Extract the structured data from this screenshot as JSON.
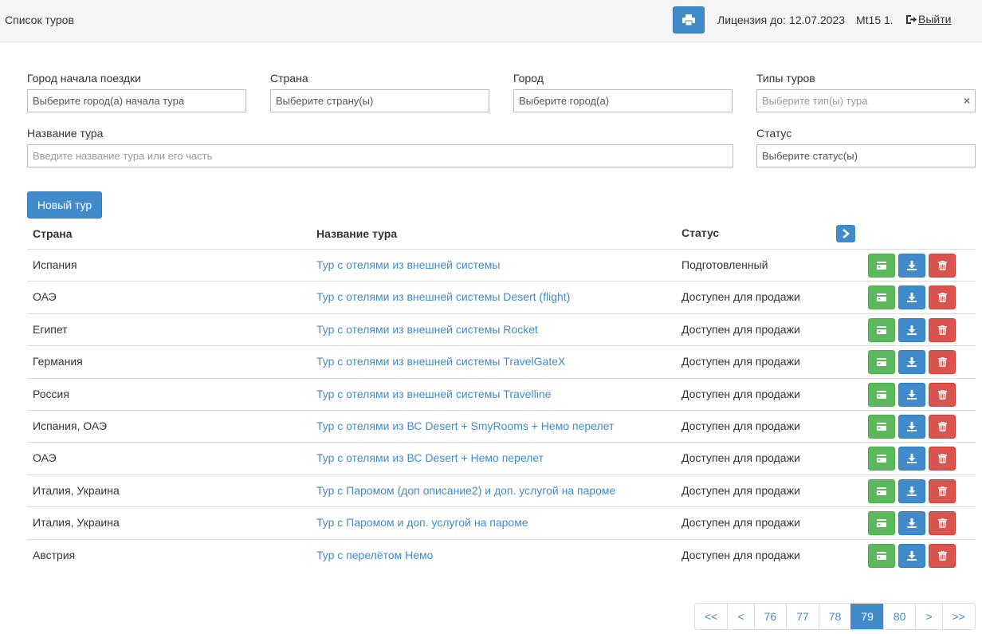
{
  "header": {
    "title": "Список туров",
    "license_label": "Лицензия до:",
    "license_date": "12.07.2023",
    "user": "Mt15 1.",
    "logout_label": "Выйти"
  },
  "filters": {
    "departure_city": {
      "label": "Город начала поездки",
      "placeholder": "Выберите город(а) начала тура"
    },
    "country": {
      "label": "Страна",
      "placeholder": "Выберите страну(ы)"
    },
    "city": {
      "label": "Город",
      "placeholder": "Выберите город(а)"
    },
    "tour_types": {
      "label": "Типы туров",
      "placeholder": "Выберите тип(ы) тура"
    },
    "tour_name": {
      "label": "Название тура",
      "placeholder": "Введите название тура или его часть"
    },
    "status": {
      "label": "Статус",
      "placeholder": "Выберите статус(ы)"
    }
  },
  "new_tour_label": "Новый тур",
  "table": {
    "headers": {
      "country": "Страна",
      "name": "Название тура",
      "status": "Статус"
    },
    "rows": [
      {
        "country": "Испания",
        "name": "Тур с отелями из внешней системы",
        "status": "Подготовленный"
      },
      {
        "country": "ОАЭ",
        "name": "Тур с отелями из внешней системы Desert (flight)",
        "status": "Доступен для продажи"
      },
      {
        "country": "Египет",
        "name": "Тур с отелями из внешней системы Rocket",
        "status": "Доступен для продажи"
      },
      {
        "country": "Германия",
        "name": "Тур с отелями из внешней системы TravelGateX",
        "status": "Доступен для продажи"
      },
      {
        "country": "Россия",
        "name": "Тур с отелями из внешней системы Travelline",
        "status": "Доступен для продажи"
      },
      {
        "country": "Испания, ОАЭ",
        "name": "Тур с отелями из ВС Desert + SmyRooms + Немо перелет",
        "status": "Доступен для продажи"
      },
      {
        "country": "ОАЭ",
        "name": "Тур с отелями из ВС Desert + Немо перелет",
        "status": "Доступен для продажи"
      },
      {
        "country": "Италия, Украина",
        "name": "Тур с Паромом (доп описание2) и доп. услугой на пароме",
        "status": "Доступен для продажи"
      },
      {
        "country": "Италия, Украина",
        "name": "Тур с Паромом и доп. услугой на пароме",
        "status": "Доступен для продажи"
      },
      {
        "country": "Австрия",
        "name": "Тур с перелётом Немо",
        "status": "Доступен для продажи"
      }
    ]
  },
  "pagination": {
    "items": [
      "<<",
      "<",
      "76",
      "77",
      "78",
      "79",
      "80",
      ">",
      ">>"
    ],
    "active": "79"
  },
  "colors": {
    "primary": "#428bca",
    "success": "#5cb85c",
    "danger": "#d9534f",
    "link": "#428bca"
  },
  "icons": {
    "print": "print-icon",
    "logout": "logout-icon",
    "next_columns": "chevron-right-icon",
    "row_actions": [
      "credit-card-icon",
      "download-icon",
      "trash-icon"
    ]
  }
}
